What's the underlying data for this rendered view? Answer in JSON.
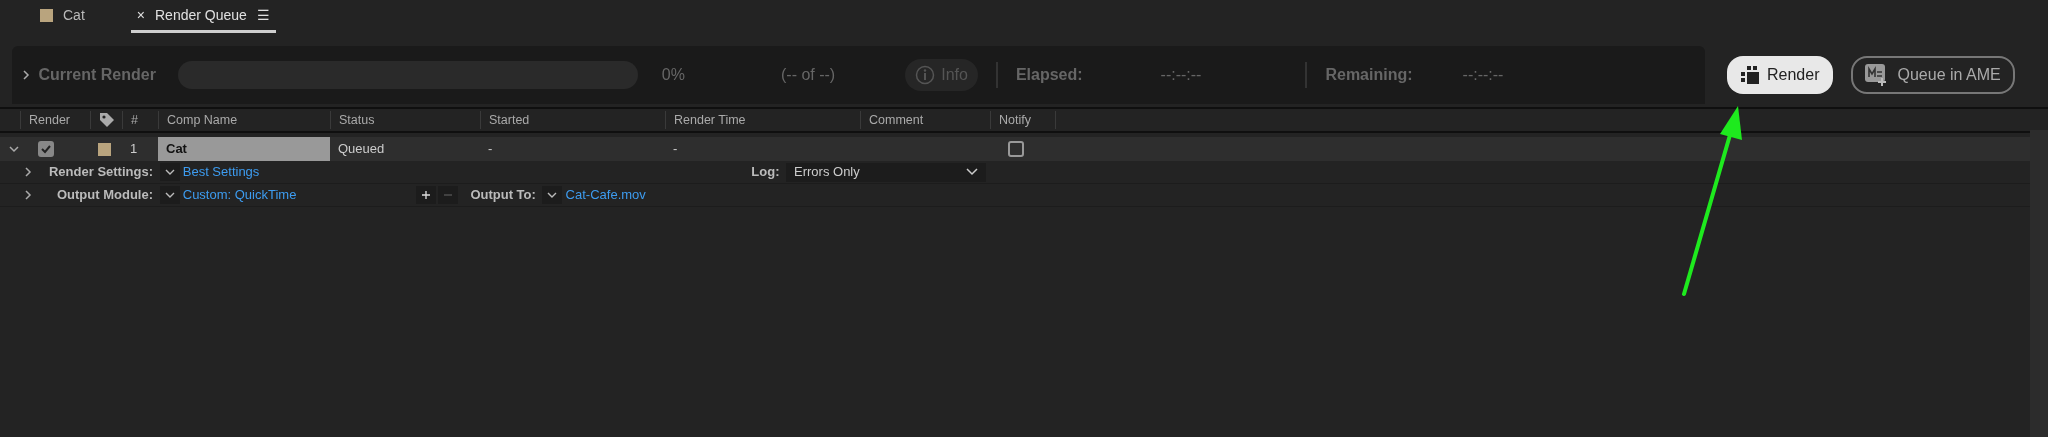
{
  "tabs": [
    {
      "label": "Cat",
      "kind": "comp",
      "color": "#b9a47e",
      "selected": false
    },
    {
      "label": "Render Queue",
      "kind": "panel",
      "close": "×",
      "menu": "☰",
      "selected": true
    }
  ],
  "current_render": {
    "title": "Current Render",
    "expanded": false,
    "level": 0,
    "percent": "0%",
    "count": "(-- of --)",
    "info": "Info",
    "elapsed_label": "Elapsed:",
    "elapsed": "--:--:--",
    "remaining_label": "Remaining:",
    "remaining": "--:--:--"
  },
  "buttons": [
    {
      "label": "Render",
      "kind": "render"
    },
    {
      "label": "Queue in AME",
      "kind": "ame"
    }
  ],
  "columns": [
    "Render",
    "#",
    "Comp Name",
    "Status",
    "Started",
    "Render Time",
    "Comment",
    "Notify"
  ],
  "rows": [
    {
      "expanded": true,
      "render": true,
      "color": "#b9a47e",
      "number": "1",
      "comp_name": "Cat",
      "status": "Queued",
      "started": "-",
      "render_time": "-",
      "comment": "",
      "notify": false,
      "render_settings": {
        "label": "Render Settings:",
        "value": "Best Settings",
        "expanded": false
      },
      "log": {
        "label": "Log:",
        "value": "Errors Only"
      },
      "output_module": {
        "label": "Output Module:",
        "value": "Custom: QuickTime",
        "expanded": false
      },
      "output_to": {
        "label": "Output To:",
        "value": "Cat-Cafe.mov"
      }
    }
  ]
}
